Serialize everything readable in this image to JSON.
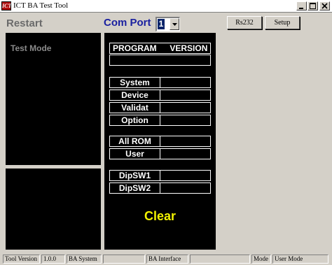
{
  "window": {
    "icon_text": "ICT",
    "title": "ICT BA Test Tool"
  },
  "header": {
    "restart_label": "Restart",
    "comport_label": "Com Port",
    "comport_value": "1",
    "rs232_label": "Rs232",
    "setup_label": "Setup"
  },
  "left_panel": {
    "test_mode_label": "Test Mode"
  },
  "info_panel": {
    "header_program": "PROGRAM",
    "header_version": "VERSION",
    "program_rows": [
      {
        "label": "System",
        "value": ""
      },
      {
        "label": "Device",
        "value": ""
      },
      {
        "label": "Validat",
        "value": ""
      },
      {
        "label": "Option",
        "value": ""
      }
    ],
    "rom_rows": [
      {
        "label": "All ROM",
        "value": ""
      },
      {
        "label": "User",
        "value": ""
      }
    ],
    "dip_rows": [
      {
        "label": "DipSW1",
        "value": ""
      },
      {
        "label": "DipSW2",
        "value": ""
      }
    ],
    "clear_label": "Clear"
  },
  "statusbar": {
    "panes": [
      "Tool Version",
      "1.0.0",
      "BA System",
      "",
      "BA Interface",
      "",
      "Mode",
      "User Mode"
    ]
  },
  "colors": {
    "title_blue": "#1a20a0",
    "clear_yellow": "#f2f200",
    "panel_black": "#000000",
    "dialog_gray": "#d4d0c8"
  }
}
